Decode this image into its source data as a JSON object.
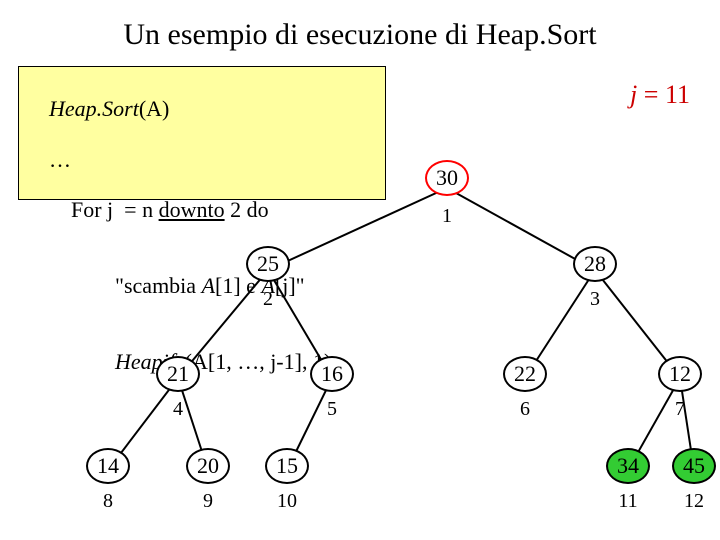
{
  "title": "Un esempio di esecuzione di Heap.Sort",
  "code": {
    "signature_fn": "Heap.Sort",
    "signature_arg": "(A)",
    "line_ellipsis": "    …",
    "line_for_prefix": "    For j  = n ",
    "line_for_keyword": "downto",
    "line_for_suffix": " 2 do",
    "line_swap_prefix": "            \"scambia ",
    "line_swap_arr1": "A",
    "line_swap_mid": "[1] e ",
    "line_swap_arr2": "A",
    "line_swap_idx": "[j]",
    "line_swap_end": "\"",
    "line_heapify_fn": "            Heapify",
    "line_heapify_args": "(A[1, …, j-1], 1)"
  },
  "state": {
    "var": "j",
    "eq": " = ",
    "value": "11"
  },
  "nodes": {
    "n1": {
      "value": "30",
      "idx": "1"
    },
    "n2": {
      "value": "25",
      "idx": "2"
    },
    "n3": {
      "value": "28",
      "idx": "3"
    },
    "n4": {
      "value": "21",
      "idx": "4"
    },
    "n5": {
      "value": "16",
      "idx": "5"
    },
    "n6": {
      "value": "22",
      "idx": "6"
    },
    "n7": {
      "value": "12",
      "idx": "7"
    },
    "n8": {
      "value": "14",
      "idx": "8"
    },
    "n9": {
      "value": "20",
      "idx": "9"
    },
    "n10": {
      "value": "15",
      "idx": "10"
    },
    "n11": {
      "value": "34",
      "idx": "11"
    },
    "n12": {
      "value": "45",
      "idx": "12"
    }
  }
}
